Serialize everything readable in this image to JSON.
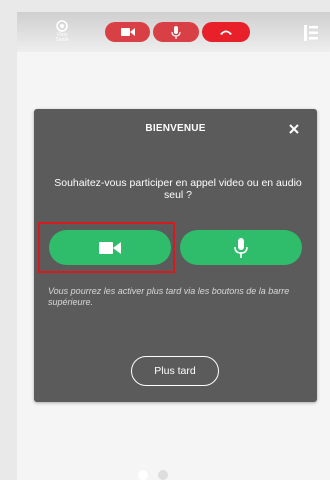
{
  "topbar": {
    "logo_text": "Visio Santé",
    "controls": [
      {
        "name": "video",
        "icon": "camera-icon",
        "color": "#d94045"
      },
      {
        "name": "mic",
        "icon": "microphone-icon",
        "color": "#d94045"
      },
      {
        "name": "hangup",
        "icon": "phone-hangup-icon",
        "color": "#e8202a"
      }
    ],
    "menu_icon": "menu-icon"
  },
  "modal": {
    "title": "BIENVENUE",
    "close_icon": "close-icon",
    "question": "Souhaitez-vous participer en appel video ou en audio seul ?",
    "video_choice_icon": "camera-icon",
    "audio_choice_icon": "microphone-icon",
    "choice_color": "#2fbd6b",
    "highlight_color": "#d71920",
    "hint": "Vous pourrez les activer plus tard via les boutons de la barre supérieure.",
    "later_label": "Plus tard"
  }
}
